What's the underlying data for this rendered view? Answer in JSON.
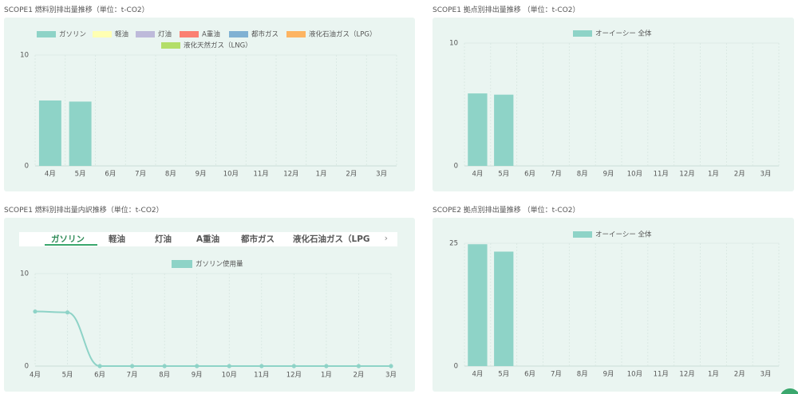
{
  "colors": {
    "gasoline": "#8ed3c7",
    "light_oil": "#ffffb3",
    "kerosene": "#bebada",
    "a_heavy_oil": "#fb8072",
    "city_gas": "#80b1d3",
    "lpg": "#fdb462",
    "lng": "#b3de69",
    "panel_bg": "#eaf5f1",
    "tab_active": "#2e8b57"
  },
  "panels": {
    "scope1_fuel": {
      "title": "SCOPE1 燃料別排出量推移（単位：t-CO2）",
      "chart_data": {
        "type": "bar",
        "categories": [
          "4月",
          "5月",
          "6月",
          "7月",
          "8月",
          "9月",
          "10月",
          "11月",
          "12月",
          "1月",
          "2月",
          "3月"
        ],
        "series": [
          {
            "name": "ガソリン",
            "values": [
              5.9,
              5.8,
              0,
              0,
              0,
              0,
              0,
              0,
              0,
              0,
              0,
              0
            ]
          },
          {
            "name": "軽油",
            "values": [
              0,
              0,
              0,
              0,
              0,
              0,
              0,
              0,
              0,
              0,
              0,
              0
            ]
          },
          {
            "name": "灯油",
            "values": [
              0,
              0,
              0,
              0,
              0,
              0,
              0,
              0,
              0,
              0,
              0,
              0
            ]
          },
          {
            "name": "A重油",
            "values": [
              0,
              0,
              0,
              0,
              0,
              0,
              0,
              0,
              0,
              0,
              0,
              0
            ]
          },
          {
            "name": "都市ガス",
            "values": [
              0,
              0,
              0,
              0,
              0,
              0,
              0,
              0,
              0,
              0,
              0,
              0
            ]
          },
          {
            "name": "液化石油ガス（LPG）",
            "values": [
              0,
              0,
              0,
              0,
              0,
              0,
              0,
              0,
              0,
              0,
              0,
              0
            ]
          },
          {
            "name": "液化天然ガス（LNG）",
            "values": [
              0,
              0,
              0,
              0,
              0,
              0,
              0,
              0,
              0,
              0,
              0,
              0
            ]
          }
        ],
        "ylim": [
          0,
          10
        ],
        "y_ticks": [
          "0",
          "10"
        ],
        "legend": "top",
        "grid": true
      }
    },
    "scope1_site": {
      "title": "SCOPE1 拠点別排出量推移 （単位：t-CO2）",
      "chart_data": {
        "type": "bar",
        "categories": [
          "4月",
          "5月",
          "6月",
          "7月",
          "8月",
          "9月",
          "10月",
          "11月",
          "12月",
          "1月",
          "2月",
          "3月"
        ],
        "series": [
          {
            "name": "オーイーシー 全体",
            "values": [
              5.9,
              5.8,
              0,
              0,
              0,
              0,
              0,
              0,
              0,
              0,
              0,
              0
            ]
          }
        ],
        "ylim": [
          0,
          10
        ],
        "y_ticks": [
          "0",
          "10"
        ],
        "legend": "top",
        "grid": true
      }
    },
    "scope1_breakdown": {
      "title": "SCOPE1 燃料別排出量内訳推移（単位：t-CO2）",
      "tabs": [
        "ガソリン",
        "軽油",
        "灯油",
        "A重油",
        "都市ガス",
        "液化石油ガス（LPG"
      ],
      "active_tab": "ガソリン",
      "next_icon": "chevron-right-icon",
      "chart_data": {
        "type": "line",
        "categories": [
          "4月",
          "5月",
          "6月",
          "7月",
          "8月",
          "9月",
          "10月",
          "11月",
          "12月",
          "1月",
          "2月",
          "3月"
        ],
        "series": [
          {
            "name": "ガソリン使用量",
            "values": [
              5.9,
              5.8,
              0,
              0,
              0,
              0,
              0,
              0,
              0,
              0,
              0,
              0
            ]
          }
        ],
        "ylim": [
          0,
          10
        ],
        "y_ticks": [
          "0",
          "10"
        ],
        "legend": "top",
        "grid": true
      }
    },
    "scope2_site": {
      "title": "SCOPE2 拠点別排出量推移 （単位：t-CO2）",
      "chart_data": {
        "type": "bar",
        "categories": [
          "4月",
          "5月",
          "6月",
          "7月",
          "8月",
          "9月",
          "10月",
          "11月",
          "12月",
          "1月",
          "2月",
          "3月"
        ],
        "series": [
          {
            "name": "オーイーシー 全体",
            "values": [
              24.8,
              23.3,
              0,
              0,
              0,
              0,
              0,
              0,
              0,
              0,
              0,
              0
            ]
          }
        ],
        "ylim": [
          0,
          25
        ],
        "y_ticks": [
          "0",
          "25"
        ],
        "legend": "top",
        "grid": true
      }
    }
  }
}
